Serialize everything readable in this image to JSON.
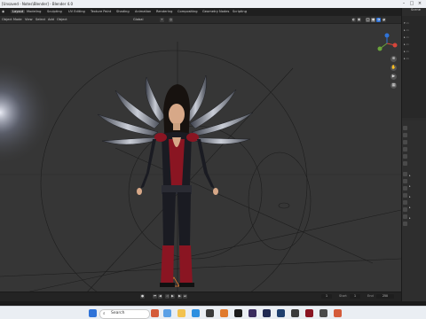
{
  "window": {
    "title": "[Unsaved - Notes\\Blender] - Blender 4.0"
  },
  "workspaces": [
    "Layout",
    "Modeling",
    "Sculpting",
    "UV Editing",
    "Texture Paint",
    "Shading",
    "Animation",
    "Rendering",
    "Compositing",
    "Geometry Nodes",
    "Scripting"
  ],
  "header": {
    "mode": "Object Mode",
    "view": "View",
    "select": "Select",
    "add": "Add",
    "object": "Object",
    "pivot": "Global",
    "options": "Options",
    "select_box": "Select Box"
  },
  "scene": {
    "label": "Scene"
  },
  "timeline": {
    "frame_start": "1",
    "frame_end": "250",
    "current_frame": "1",
    "start_label": "Start",
    "end_label": "End"
  },
  "taskbar": {
    "search_placeholder": "Search"
  },
  "colors": {
    "accent": "#2f73d8",
    "suit_red": "#8a1522",
    "suit_dark": "#1a1b22"
  }
}
